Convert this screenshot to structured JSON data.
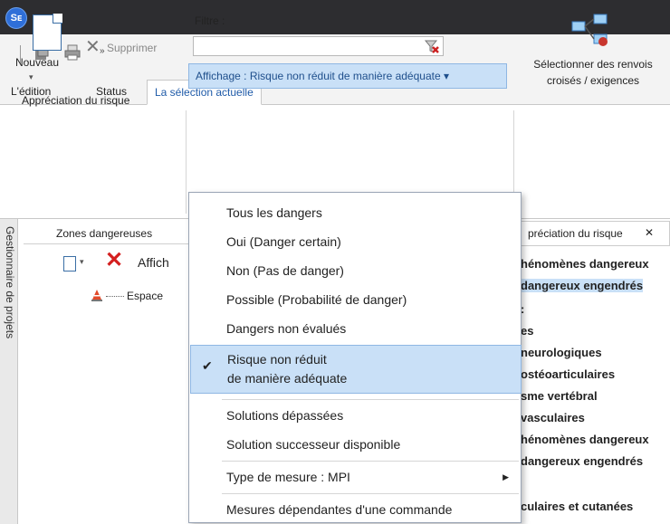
{
  "app": {
    "logo_text": "Sᴇ"
  },
  "tabs": [
    {
      "label": "L'édition"
    },
    {
      "label": "Status"
    },
    {
      "label": "La sélection actuelle",
      "active": true
    }
  ],
  "ribbon": {
    "new_label": "Nouveau",
    "delete_label": "Supprimer",
    "filter_label": "Filtre :",
    "filter_value": "",
    "affichage_label": "Affichage : Risque non réduit de manière adéquate ▾",
    "group_label": "Appréciation du risque",
    "crossref_label_line1": "Sélectionner des renvois",
    "crossref_label_line2": "croisés / exigences"
  },
  "sidebar": {
    "label": "Gestionnaire de projets"
  },
  "left_pane": {
    "title": "Zones dangereuses",
    "affich": "Affich",
    "tree_item": "Espace"
  },
  "right_pane": {
    "tab_label": "préciation du risque",
    "tab_close": "✕",
    "lines": [
      "hénomènes dangereux",
      "dangereux engendrés",
      ":",
      "es",
      "neurologiques",
      "ostéoarticulaires",
      "sme vertébral",
      "vasculaires",
      "hénomènes dangereux",
      "dangereux engendrés",
      "",
      "culaires et cutanées"
    ]
  },
  "menu": {
    "items": [
      {
        "label": "Tous les dangers"
      },
      {
        "label": "Oui (Danger certain)"
      },
      {
        "label": "Non (Pas de danger)"
      },
      {
        "label": "Possible (Probabilité de danger)"
      },
      {
        "label": "Dangers non évalués"
      },
      {
        "label": "Risque non réduit",
        "label2": "de manière adéquate",
        "checked": true,
        "check": "✔"
      },
      {
        "label": "Solutions dépassées"
      },
      {
        "label": "Solution successeur disponible"
      },
      {
        "label": "Type de mesure : MPI",
        "arrow": "▶"
      },
      {
        "label": "Mesures dépendantes d'une commande"
      }
    ]
  },
  "colors": {
    "titlebar": "#2d2d30",
    "accent": "#1e5aa8",
    "selection": "#c9e0f7",
    "delete_red": "#d42020"
  }
}
